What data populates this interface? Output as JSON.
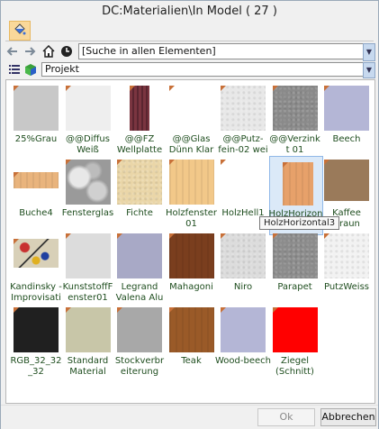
{
  "window": {
    "title": "DC:Materialien\\In Model ( 27 )"
  },
  "toolbar": {
    "paint_icon": "paint-bucket-icon"
  },
  "nav": {
    "search_value": "[Suche in allen Elementen]",
    "view_value": "Projekt"
  },
  "materials": [
    {
      "label": "25%Grau",
      "color": "#c8c8c8",
      "pattern": "solid"
    },
    {
      "label": "@@Diffus Weiß",
      "color": "#eeeeee",
      "pattern": "solid"
    },
    {
      "label": "@@FZ Wellplatte",
      "color": "#7a3540",
      "pattern": "stripes"
    },
    {
      "label": "@@Glas Dünn Klar",
      "color": "#ffffff",
      "pattern": "solid"
    },
    {
      "label": "@@Putz-fein-02 wei",
      "color": "#e8e8e8",
      "pattern": "noise"
    },
    {
      "label": "@@Verzink t 01",
      "color": "#8a8a8a",
      "pattern": "noise"
    },
    {
      "label": "Beech",
      "color": "#b4b6d6",
      "pattern": "solid"
    },
    {
      "label": "Buche4",
      "color": "#e9b47d",
      "pattern": "wood"
    },
    {
      "label": "Fensterglas",
      "color": "#9a9a9a",
      "pattern": "cloud"
    },
    {
      "label": "Fichte",
      "color": "#ead6a8",
      "pattern": "noise"
    },
    {
      "label": "Holzfenster 01",
      "color": "#f2c889",
      "pattern": "wood"
    },
    {
      "label": "HolzHell1",
      "color": "#ffffff",
      "pattern": "solid"
    },
    {
      "label": "HolzHorizontal3",
      "color": "#e7a16a",
      "pattern": "wood"
    },
    {
      "label": "Kaffee Braun",
      "color": "#9a7a5a",
      "pattern": "solid"
    },
    {
      "label": "Kandinsky - Improvisati",
      "color": "#d8d0b8",
      "pattern": "art"
    },
    {
      "label": "KunststoffF enster01",
      "color": "#dcdcdc",
      "pattern": "solid"
    },
    {
      "label": "Legrand Valena Alu",
      "color": "#a8a9c6",
      "pattern": "solid"
    },
    {
      "label": "Mahagoni",
      "color": "#7a3e1e",
      "pattern": "wood"
    },
    {
      "label": "Niro",
      "color": "#dcdcdc",
      "pattern": "noise"
    },
    {
      "label": "Parapet",
      "color": "#8c8c8c",
      "pattern": "noise"
    },
    {
      "label": "PutzWeiss",
      "color": "#f2f2f2",
      "pattern": "noise"
    },
    {
      "label": "RGB_32_32 _32",
      "color": "#202020",
      "pattern": "solid"
    },
    {
      "label": "Standard Material",
      "color": "#c8c6a8",
      "pattern": "solid"
    },
    {
      "label": "Stockverbr eiterung",
      "color": "#a8a8a8",
      "pattern": "solid"
    },
    {
      "label": "Teak",
      "color": "#9a5a28",
      "pattern": "wood"
    },
    {
      "label": "Wood-beech",
      "color": "#b4b6d6",
      "pattern": "solid"
    },
    {
      "label": "Ziegel (Schnitt)",
      "color": "#ff0000",
      "pattern": "solid"
    }
  ],
  "selected_index": 12,
  "tooltip": "HolzHorizontal3",
  "buttons": {
    "ok": "Ok",
    "cancel": "Abbrechen"
  }
}
